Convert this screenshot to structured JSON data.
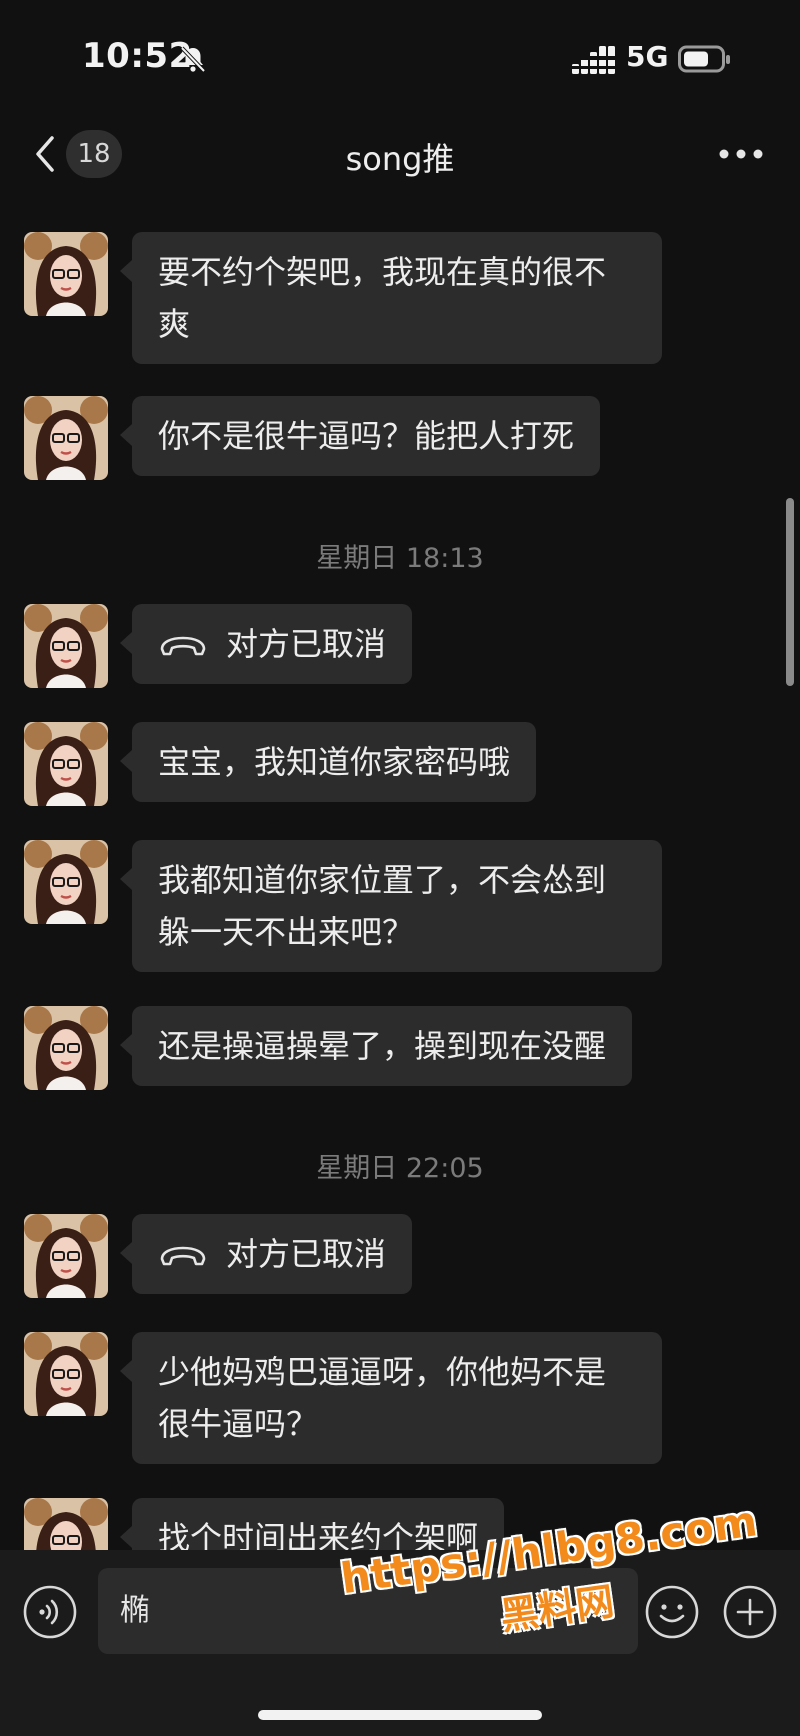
{
  "status_bar": {
    "time": "10:52",
    "network": "5G",
    "mute_icon": "bell-slash-icon",
    "signal_icon": "signal-icon",
    "battery_icon": "battery-icon"
  },
  "header": {
    "unread_count": "18",
    "title": "song推",
    "back_icon": "chevron-left-icon",
    "more_icon": "more-dots-icon"
  },
  "messages": [
    {
      "type": "text",
      "text": "要不约个架吧，我现在真的很不爽"
    },
    {
      "type": "text",
      "text": "你不是很牛逼吗？能把人打死"
    },
    {
      "type": "timestamp",
      "text": "星期日 18:13"
    },
    {
      "type": "call",
      "text": "对方已取消",
      "icon": "phone-hangup-icon"
    },
    {
      "type": "text",
      "text": "宝宝，我知道你家密码哦"
    },
    {
      "type": "text",
      "text": "我都知道你家位置了，不会怂到躲一天不出来吧？"
    },
    {
      "type": "text",
      "text": "还是操逼操晕了，操到现在没醒"
    },
    {
      "type": "timestamp",
      "text": "星期日 22:05"
    },
    {
      "type": "call",
      "text": "对方已取消",
      "icon": "phone-hangup-icon"
    },
    {
      "type": "text",
      "text": "少他妈鸡巴逼逼呀，你他妈不是很牛逼吗？"
    },
    {
      "type": "text",
      "text": "找个时间出来约个架啊"
    }
  ],
  "input": {
    "value": "椭",
    "voice_icon": "voice-icon",
    "emoji_icon": "emoji-icon",
    "plus_icon": "plus-icon"
  },
  "watermark": {
    "url": "https://hlbg8.com",
    "name": "黑料网"
  },
  "colors": {
    "background": "#111111",
    "bubble": "#2c2c2c",
    "text": "#ededed",
    "timestamp": "#7b7b7b",
    "watermark": "#f28a1c"
  }
}
